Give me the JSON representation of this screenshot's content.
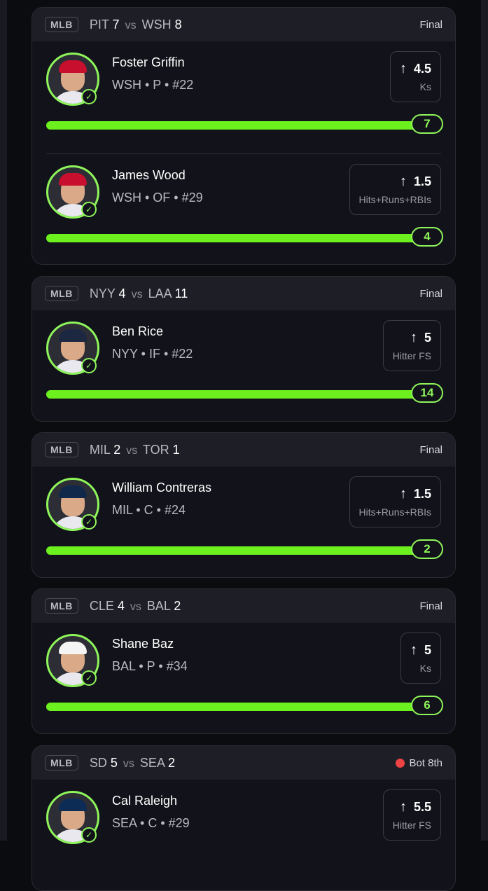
{
  "colors": {
    "accent": "#6cf01e",
    "live": "#f04444",
    "card": "#12131a",
    "header": "#1e1f26"
  },
  "games": [
    {
      "league": "MLB",
      "away": {
        "team": "PIT",
        "score": "7"
      },
      "vs": "vs",
      "home": {
        "team": "WSH",
        "score": "8"
      },
      "status": "Final",
      "live": false,
      "players": [
        {
          "name": "Foster Griffin",
          "meta": "WSH • P • #22",
          "line": "4.5",
          "stat": "Ks",
          "result": "7",
          "progress": 1.0,
          "cap_color": "#c8102e"
        },
        {
          "name": "James Wood",
          "meta": "WSH • OF • #29",
          "line": "1.5",
          "stat": "Hits+Runs+RBIs",
          "result": "4",
          "progress": 1.0,
          "cap_color": "#c8102e"
        }
      ]
    },
    {
      "league": "MLB",
      "away": {
        "team": "NYY",
        "score": "4"
      },
      "vs": "vs",
      "home": {
        "team": "LAA",
        "score": "11"
      },
      "status": "Final",
      "live": false,
      "players": [
        {
          "name": "Ben Rice",
          "meta": "NYY • IF • #22",
          "line": "5",
          "stat": "Hitter FS",
          "result": "14",
          "progress": 1.0,
          "cap_color": "#1c2841"
        }
      ]
    },
    {
      "league": "MLB",
      "away": {
        "team": "MIL",
        "score": "2"
      },
      "vs": "vs",
      "home": {
        "team": "TOR",
        "score": "1"
      },
      "status": "Final",
      "live": false,
      "players": [
        {
          "name": "William Contreras",
          "meta": "MIL • C • #24",
          "line": "1.5",
          "stat": "Hits+Runs+RBIs",
          "result": "2",
          "progress": 1.0,
          "cap_color": "#12284b"
        }
      ]
    },
    {
      "league": "MLB",
      "away": {
        "team": "CLE",
        "score": "4"
      },
      "vs": "vs",
      "home": {
        "team": "BAL",
        "score": "2"
      },
      "status": "Final",
      "live": false,
      "players": [
        {
          "name": "Shane Baz",
          "meta": "BAL • P • #34",
          "line": "5",
          "stat": "Ks",
          "result": "6",
          "progress": 1.0,
          "cap_color": "#f5f5f5"
        }
      ]
    },
    {
      "league": "MLB",
      "away": {
        "team": "SD",
        "score": "5"
      },
      "vs": "vs",
      "home": {
        "team": "SEA",
        "score": "2"
      },
      "status": "Bot 8th",
      "live": true,
      "players": [
        {
          "name": "Cal Raleigh",
          "meta": "SEA • C • #29",
          "line": "5.5",
          "stat": "Hitter FS",
          "result": "",
          "progress": 0,
          "cap_color": "#0c2c56"
        }
      ]
    }
  ]
}
